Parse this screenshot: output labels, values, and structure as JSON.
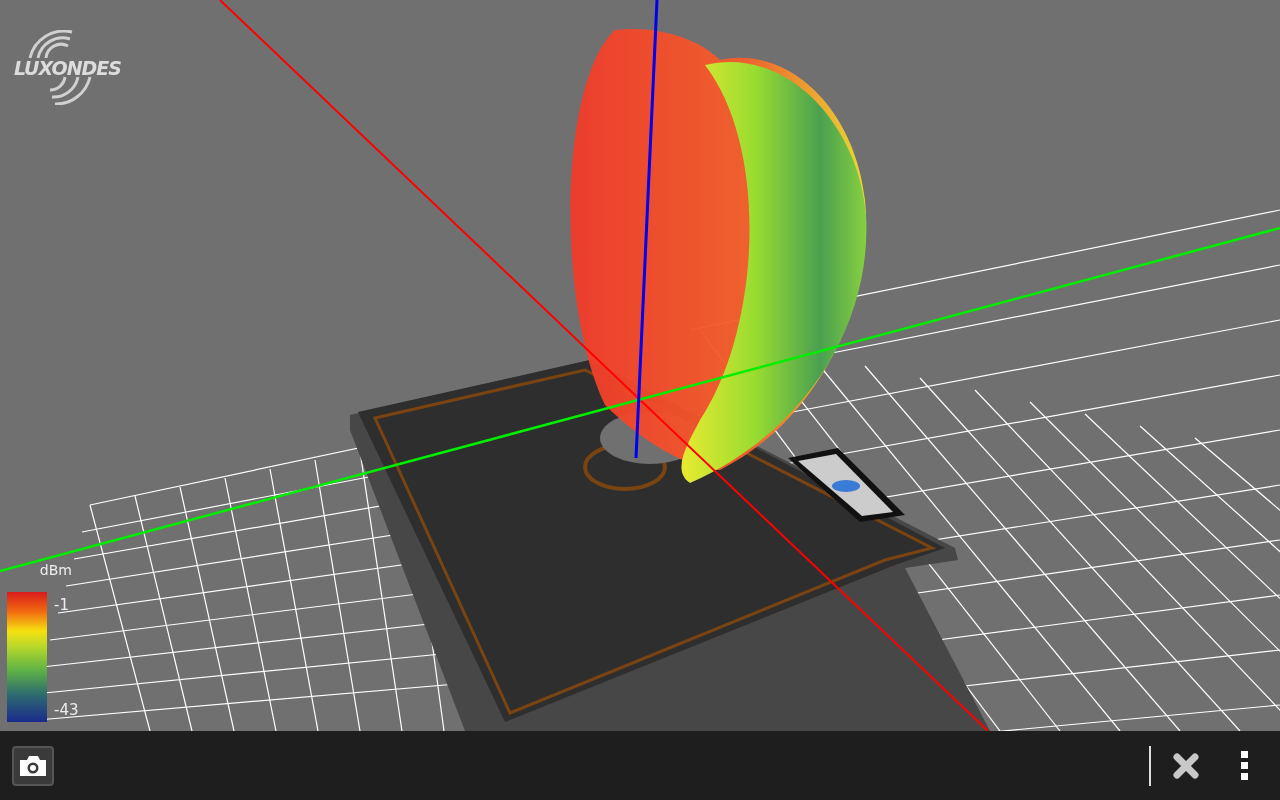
{
  "logo": {
    "text": "LUXONDES"
  },
  "legend": {
    "unit": "dBm",
    "max_label": "-1",
    "min_label": "-43"
  }
}
